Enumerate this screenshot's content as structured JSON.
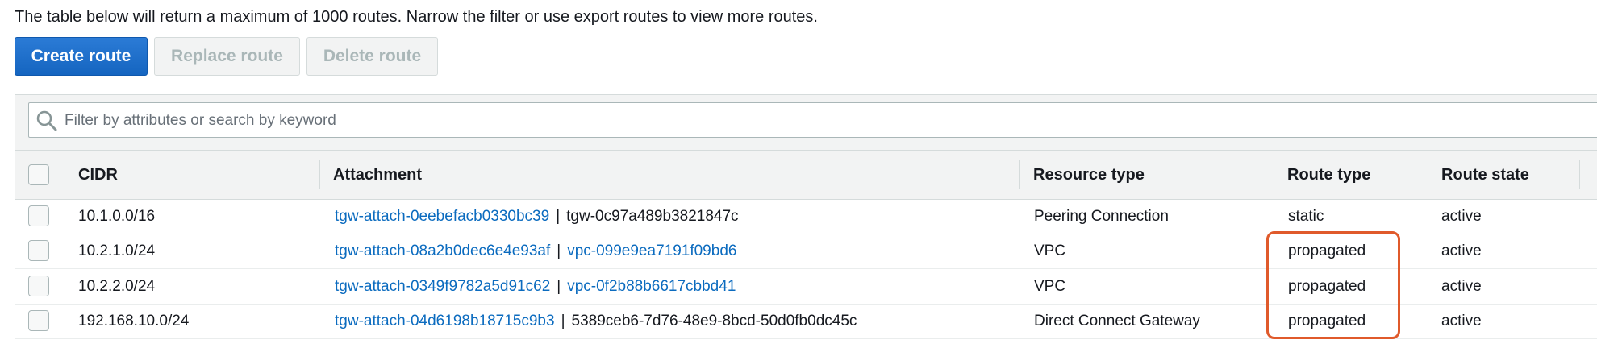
{
  "info_text": "The table below will return a maximum of 1000 routes. Narrow the filter or use export routes to view more routes.",
  "toolbar": {
    "create_label": "Create route",
    "replace_label": "Replace route",
    "delete_label": "Delete route"
  },
  "search": {
    "placeholder": "Filter by attributes or search by keyword",
    "value": ""
  },
  "table": {
    "columns": [
      "CIDR",
      "Attachment",
      "Resource type",
      "Route type",
      "Route state"
    ],
    "rows": [
      {
        "cidr": "10.1.0.0/16",
        "attachment_id": "tgw-attach-0eebefacb0330bc39",
        "attachment_target": "tgw-0c97a489b3821847c",
        "target_is_link": false,
        "resource_type": "Peering Connection",
        "route_type": "static",
        "route_state": "active"
      },
      {
        "cidr": "10.2.1.0/24",
        "attachment_id": "tgw-attach-08a2b0dec6e4e93af",
        "attachment_target": "vpc-099e9ea7191f09bd6",
        "target_is_link": true,
        "resource_type": "VPC",
        "route_type": "propagated",
        "route_state": "active"
      },
      {
        "cidr": "10.2.2.0/24",
        "attachment_id": "tgw-attach-0349f9782a5d91c62",
        "attachment_target": "vpc-0f2b88b6617cbbd41",
        "target_is_link": true,
        "resource_type": "VPC",
        "route_type": "propagated",
        "route_state": "active"
      },
      {
        "cidr": "192.168.10.0/24",
        "attachment_id": "tgw-attach-04d6198b18715c9b3",
        "attachment_target": "5389ceb6-7d76-48e9-8bcd-50d0fb0dc45c",
        "target_is_link": false,
        "resource_type": "Direct Connect Gateway",
        "route_type": "propagated",
        "route_state": "active"
      }
    ]
  },
  "colors": {
    "primary_button": "#1565c0",
    "link": "#0b6bbf",
    "highlight_border": "#e05a2b"
  },
  "icons": {
    "search": "search-icon"
  }
}
